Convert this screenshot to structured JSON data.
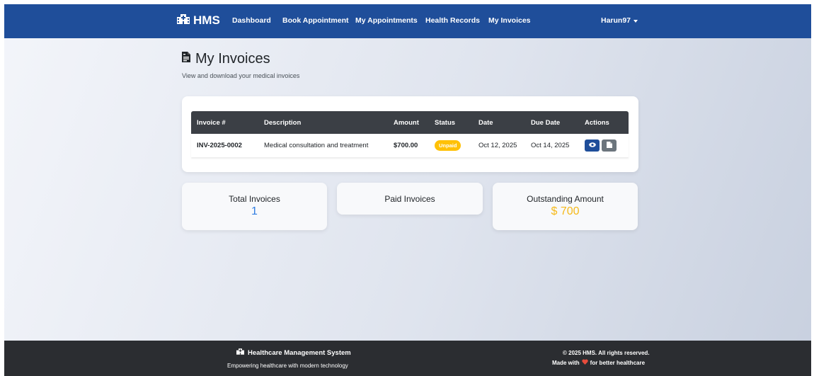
{
  "navbar": {
    "brand": "HMS",
    "links": [
      "Dashboard",
      "Book Appointment",
      "My Appointments",
      "Health Records",
      "My Invoices"
    ],
    "user": "Harun97"
  },
  "header": {
    "title": "My Invoices",
    "subtitle": "View and download your medical invoices"
  },
  "invoices": {
    "columns": [
      "Invoice #",
      "Description",
      "Amount",
      "Status",
      "Date",
      "Due Date",
      "Actions"
    ],
    "rows": [
      {
        "invoice": "INV-2025-0002",
        "description": "Medical consultation and treatment",
        "amount": "$700.00",
        "status": "Unpaid",
        "date": "Oct 12, 2025",
        "due": "Oct 14, 2025",
        "actions": [
          "eye-icon",
          "file-pdf-icon"
        ]
      }
    ]
  },
  "stats": {
    "total_label": "Total Invoices",
    "total_value": "1",
    "paid_label": "Paid Invoices",
    "outstanding_label": "Outstanding Amount",
    "outstanding_value": "$ 700"
  },
  "footer": {
    "title": "Healthcare Management System",
    "tagline": "Empowering healthcare with modern technology",
    "copyright": "© 2025 HMS. All rights reserved.",
    "made_prefix": "Made with",
    "made_suffix": "for better healthcare"
  },
  "colors": {
    "navbar": "#1f4e9a",
    "table_header": "#3b3f45",
    "status_unpaid": "#ffc107",
    "total_value": "#2f7de1",
    "outstanding_value": "#f5b91a",
    "footer": "#2b2d31",
    "heart": "#e74c3c"
  }
}
